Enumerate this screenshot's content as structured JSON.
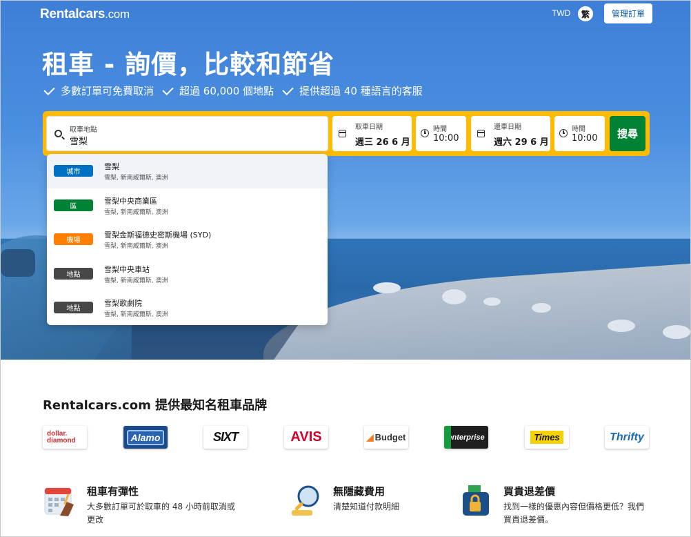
{
  "header": {
    "logo_main": "Rentalcars",
    "logo_suffix": ".com",
    "currency": "TWD",
    "language": "繁",
    "manage_booking": "管理訂單"
  },
  "hero": {
    "headline": "租車 - 詢價，比較和節省",
    "perks": [
      "多數訂單可免費取消",
      "超過 60,000 個地點",
      "提供超過 40 種語言的客服"
    ]
  },
  "search": {
    "pickup_location_label": "取車地點",
    "pickup_location_value": "雪梨",
    "pickup_date_label": "取車日期",
    "pickup_date_value": "週三 26 6 月",
    "pickup_time_label": "時間",
    "pickup_time_value": "10:00",
    "dropoff_date_label": "還車日期",
    "dropoff_date_value": "週六 29 6 月",
    "dropoff_time_label": "時間",
    "dropoff_time_value": "10:00",
    "search_button": "搜尋"
  },
  "suggestions": [
    {
      "type": "城市",
      "color": "#0071c2",
      "name": "雪梨",
      "sub": "雪梨, 新南威爾斯, 澳洲"
    },
    {
      "type": "區",
      "color": "#008234",
      "name": "雪梨中央商業區",
      "sub": "雪梨, 新南威爾斯, 澳洲"
    },
    {
      "type": "機場",
      "color": "#ff8000",
      "name": "雪梨金斯福德史密斯機場 (SYD)",
      "sub": "雪梨, 新南威爾斯, 澳洲"
    },
    {
      "type": "地點",
      "color": "#474747",
      "name": "雪梨中央車站",
      "sub": "雪梨, 新南威爾斯, 澳洲"
    },
    {
      "type": "地點",
      "color": "#474747",
      "name": "雪梨歌劇院",
      "sub": "雪梨, 新南威爾斯, 澳洲"
    }
  ],
  "brands": {
    "title": "Rentalcars.com 提供最知名租車品牌",
    "items": [
      "dollar.",
      "diamond",
      "Alamo",
      "SIXT",
      "AVIS",
      "Budget",
      "enterprise",
      "Times",
      "Thrifty"
    ]
  },
  "features": [
    {
      "title": "租車有彈性",
      "desc": "大多數訂單可於取車的 48 小時前取消或更改",
      "icon": "calendar-icon"
    },
    {
      "title": "無隱藏費用",
      "desc": "清楚知道付款明細",
      "icon": "magnifier-icon"
    },
    {
      "title": "買貴退差價",
      "desc": "找到一樣的優惠內容但價格更低？我們買貴退差價。",
      "icon": "wallet-icon"
    }
  ]
}
